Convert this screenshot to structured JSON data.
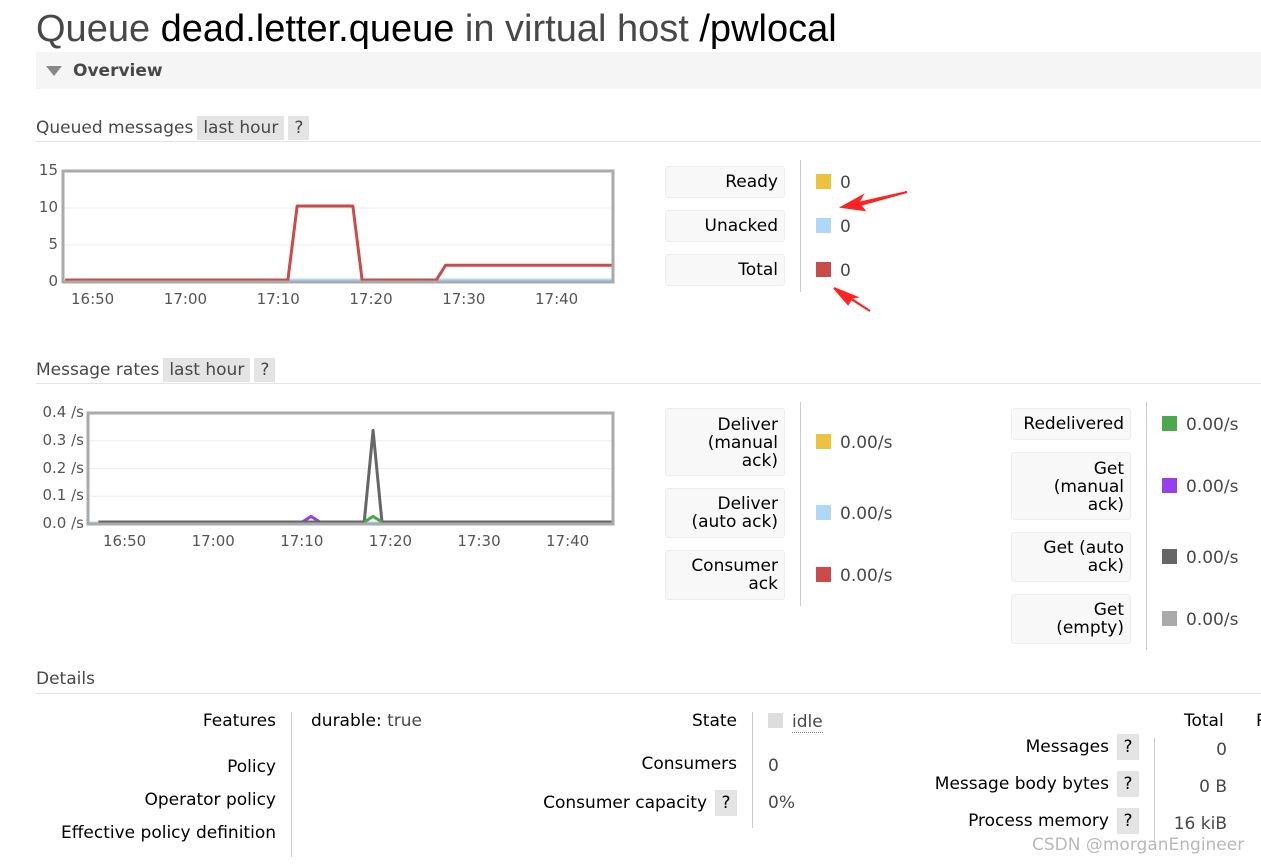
{
  "title": {
    "prefix": "Queue",
    "queue": "dead.letter.queue",
    "mid": "in virtual host",
    "vhost": "/pwlocal"
  },
  "overview": {
    "label": "Overview"
  },
  "queued": {
    "label": "Queued messages",
    "range": "last hour",
    "help": "?",
    "legend": [
      {
        "label": "Ready",
        "value": "0",
        "color": "#edc240"
      },
      {
        "label": "Unacked",
        "value": "0",
        "color": "#afd8f8"
      },
      {
        "label": "Total",
        "value": "0",
        "color": "#cb4b4b"
      }
    ]
  },
  "rates": {
    "label": "Message rates",
    "range": "last hour",
    "help": "?",
    "legend_left": [
      {
        "label": "Deliver (manual ack)",
        "value": "0.00/s",
        "color": "#edc240"
      },
      {
        "label": "Deliver (auto ack)",
        "value": "0.00/s",
        "color": "#afd8f8"
      },
      {
        "label": "Consumer ack",
        "value": "0.00/s",
        "color": "#cb4b4b"
      }
    ],
    "legend_right": [
      {
        "label": "Redelivered",
        "value": "0.00/s",
        "color": "#4da74d"
      },
      {
        "label": "Get (manual ack)",
        "value": "0.00/s",
        "color": "#9440ed"
      },
      {
        "label": "Get (auto ack)",
        "value": "0.00/s",
        "color": "#666666"
      },
      {
        "label": "Get (empty)",
        "value": "0.00/s",
        "color": "#aaaaaa"
      }
    ]
  },
  "chart_data": [
    {
      "type": "line",
      "title": "Queued messages",
      "xlabel": "",
      "ylabel": "",
      "ylim": [
        0,
        15
      ],
      "yticks": [
        "15",
        "10",
        "5",
        "0"
      ],
      "xticks": [
        "16:50",
        "17:00",
        "17:10",
        "17:20",
        "17:30",
        "17:40"
      ],
      "grid": true,
      "series": [
        {
          "name": "Unacked",
          "color": "#afd8f8",
          "x": [
            "16:47",
            "17:46"
          ],
          "y": [
            0,
            0
          ]
        },
        {
          "name": "Total",
          "color": "#cb4b4b",
          "x": [
            "16:47",
            "17:11",
            "17:12",
            "17:18",
            "17:19",
            "17:27",
            "17:28",
            "17:46"
          ],
          "y": [
            0,
            0,
            10,
            10,
            0,
            0,
            2,
            2
          ]
        }
      ]
    },
    {
      "type": "line",
      "title": "Message rates",
      "xlabel": "",
      "ylabel": "",
      "ylim": [
        0,
        0.4
      ],
      "yticks": [
        "0.4 /s",
        "0.3 /s",
        "0.2 /s",
        "0.1 /s",
        "0.0 /s"
      ],
      "xticks": [
        "16:50",
        "17:00",
        "17:10",
        "17:20",
        "17:30",
        "17:40"
      ],
      "grid": true,
      "series": [
        {
          "name": "Get (manual ack)",
          "color": "#9440ed",
          "x": [
            "17:10",
            "17:11",
            "17:12"
          ],
          "y": [
            0,
            0.02,
            0
          ]
        },
        {
          "name": "Get (auto ack)",
          "color": "#666666",
          "x": [
            "16:47",
            "17:17",
            "17:18",
            "17:19",
            "17:46"
          ],
          "y": [
            0,
            0,
            0.33,
            0,
            0
          ]
        },
        {
          "name": "Redelivered",
          "color": "#4da74d",
          "x": [
            "17:17",
            "17:18",
            "17:19"
          ],
          "y": [
            0,
            0.02,
            0
          ]
        }
      ]
    }
  ],
  "details": {
    "label": "Details",
    "features_label": "Features",
    "features_key": "durable:",
    "features_value": "true",
    "policy": "Policy",
    "operator_policy": "Operator policy",
    "effective_policy": "Effective policy definition",
    "state_label": "State",
    "state_value": "idle",
    "consumers_label": "Consumers",
    "consumers_value": "0",
    "capacity_label": "Consumer capacity",
    "capacity_value": "0%",
    "help": "?",
    "total_header": "Total",
    "messages_label": "Messages",
    "messages_value": "0",
    "body_bytes_label": "Message body bytes",
    "body_bytes_value": "0 B",
    "memory_label": "Process memory",
    "memory_value": "16 kiB"
  },
  "watermark": "CSDN @morganEngineer"
}
